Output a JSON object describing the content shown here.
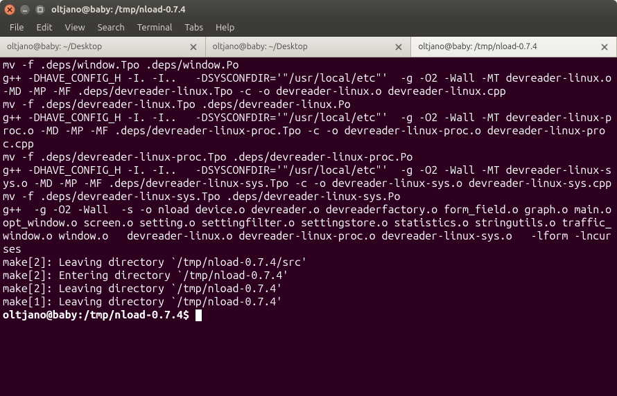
{
  "window": {
    "title": "oltjano@baby: /tmp/nload-0.7.4"
  },
  "menu": {
    "items": [
      "File",
      "Edit",
      "View",
      "Search",
      "Terminal",
      "Tabs",
      "Help"
    ]
  },
  "tabs": [
    {
      "label": "oltjano@baby: ~/Desktop",
      "active": false
    },
    {
      "label": "oltjano@baby: ~/Desktop",
      "active": false
    },
    {
      "label": "oltjano@baby: /tmp/nload-0.7.4",
      "active": true
    }
  ],
  "terminal": {
    "lines": [
      "mv -f .deps/window.Tpo .deps/window.Po",
      "g++ -DHAVE_CONFIG_H -I. -I..   -DSYSCONFDIR='\"/usr/local/etc\"'  -g -O2 -Wall -MT devreader-linux.o -MD -MP -MF .deps/devreader-linux.Tpo -c -o devreader-linux.o devreader-linux.cpp",
      "mv -f .deps/devreader-linux.Tpo .deps/devreader-linux.Po",
      "g++ -DHAVE_CONFIG_H -I. -I..   -DSYSCONFDIR='\"/usr/local/etc\"'  -g -O2 -Wall -MT devreader-linux-proc.o -MD -MP -MF .deps/devreader-linux-proc.Tpo -c -o devreader-linux-proc.o devreader-linux-proc.cpp",
      "mv -f .deps/devreader-linux-proc.Tpo .deps/devreader-linux-proc.Po",
      "g++ -DHAVE_CONFIG_H -I. -I..   -DSYSCONFDIR='\"/usr/local/etc\"'  -g -O2 -Wall -MT devreader-linux-sys.o -MD -MP -MF .deps/devreader-linux-sys.Tpo -c -o devreader-linux-sys.o devreader-linux-sys.cpp",
      "mv -f .deps/devreader-linux-sys.Tpo .deps/devreader-linux-sys.Po",
      "g++  -g -O2 -Wall  -s -o nload device.o devreader.o devreaderfactory.o form_field.o graph.o main.o opt_window.o screen.o setting.o settingfilter.o settingstore.o statistics.o stringutils.o traffic_window.o window.o   devreader-linux.o devreader-linux-proc.o devreader-linux-sys.o   -lform -lncurses",
      "make[2]: Leaving directory `/tmp/nload-0.7.4/src'",
      "make[2]: Entering directory `/tmp/nload-0.7.4'",
      "make[2]: Leaving directory `/tmp/nload-0.7.4'",
      "make[1]: Leaving directory `/tmp/nload-0.7.4'"
    ],
    "prompt": {
      "user_host": "oltjano@baby",
      "path": "/tmp/nload-0.7.4",
      "symbol": "$"
    }
  }
}
